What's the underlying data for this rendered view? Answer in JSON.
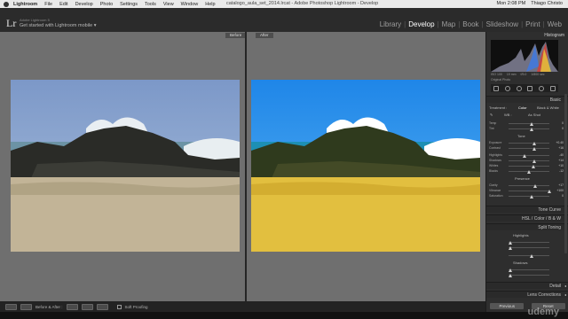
{
  "menubar": {
    "items": [
      "Lightroom",
      "File",
      "Edit",
      "Develop",
      "Photo",
      "Settings",
      "Tools",
      "View",
      "Window",
      "Help"
    ],
    "doc_title": "catalogo_aula_set_2014.lrcat - Adobe Photoshop Lightroom - Develop",
    "clock": "Mon 2:08 PM",
    "user": "Thiago Christo"
  },
  "header": {
    "logo": "Lr",
    "identity_small": "Adobe Lightroom 5",
    "identity_main": "Get started with Lightroom mobile ▾",
    "modules": [
      "Library",
      "Develop",
      "Map",
      "Book",
      "Slideshow",
      "Print",
      "Web"
    ],
    "active_module": "Develop"
  },
  "compare": {
    "before_label": "Before",
    "after_label": "After"
  },
  "toolbar": {
    "compare_mode": "Before & After :",
    "soft_proofing": "Soft Proofing"
  },
  "right_panel": {
    "histogram_title": "Histogram",
    "hist_info": [
      "ISO 100",
      "19 mm",
      "f/5.0",
      "1/800 sec"
    ],
    "original_photo": "Original Photo",
    "basic_title": "Basic",
    "treatment_label": "Treatment :",
    "treatment_options": [
      "Color",
      "Black & White"
    ],
    "profile_label": "As Shot",
    "tone_label": "Tone",
    "presence_label": "Presence",
    "tone_curve": "Tone Curve",
    "hsl": "HSL / Color / B & W",
    "split_toning": "Split Toning",
    "highlights_label": "Highlights",
    "shadows_label": "Shadows",
    "detail": "Detail",
    "lens_corrections": "Lens Corrections",
    "sliders": [
      {
        "label": "Temp",
        "value": "0"
      },
      {
        "label": "Tint",
        "value": "0"
      },
      {
        "label": "Exposure",
        "value": "+0.40"
      },
      {
        "label": "Contrast",
        "value": "+16"
      },
      {
        "label": "Highlights",
        "value": "-40"
      },
      {
        "label": "Shadows",
        "value": "+14"
      },
      {
        "label": "Whites",
        "value": "+10"
      },
      {
        "label": "Blacks",
        "value": "-12"
      },
      {
        "label": "Clarity",
        "value": "+17"
      },
      {
        "label": "Vibrance",
        "value": "+100"
      },
      {
        "label": "Saturation",
        "value": "0"
      }
    ],
    "previous_button": "Previous",
    "reset_button": "Reset"
  },
  "watermark": "udemy"
}
